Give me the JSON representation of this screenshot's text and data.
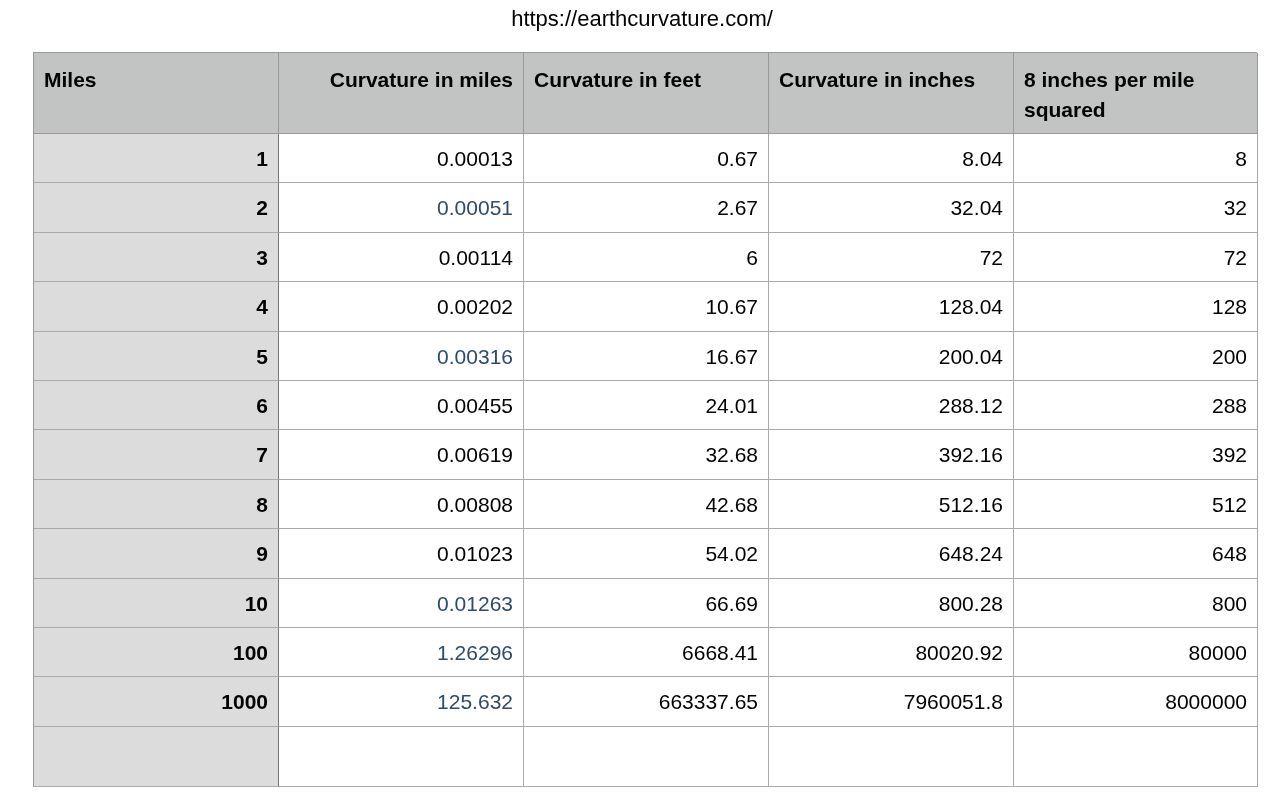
{
  "url": "https://earthcurvature.com/",
  "table": {
    "columns": [
      "Miles",
      "Curvature in miles",
      "Curvature in feet",
      "Curvature in inches",
      "8 inches per mile squared"
    ],
    "rows": [
      {
        "miles": "1",
        "curvature_miles": {
          "text": "0.00013",
          "color": "#000000"
        },
        "feet": "0.67",
        "inches": "8.04",
        "rule": "8"
      },
      {
        "miles": "2",
        "curvature_miles": {
          "text": "0.00051",
          "color": "#2e4a6e"
        },
        "feet": "2.67",
        "inches": "32.04",
        "rule": "32"
      },
      {
        "miles": "3",
        "curvature_miles": {
          "text": "0.00114",
          "color": "#000000"
        },
        "feet": "6",
        "inches": "72",
        "rule": "72"
      },
      {
        "miles": "4",
        "curvature_miles": {
          "text": "0.00202",
          "color": "#000000"
        },
        "feet": "10.67",
        "inches": "128.04",
        "rule": "128"
      },
      {
        "miles": "5",
        "curvature_miles": {
          "text": "0.00316",
          "color": "#2e4a6e"
        },
        "feet": "16.67",
        "inches": "200.04",
        "rule": "200"
      },
      {
        "miles": "6",
        "curvature_miles": {
          "text": "0.00455",
          "color": "#000000"
        },
        "feet": "24.01",
        "inches": "288.12",
        "rule": "288"
      },
      {
        "miles": "7",
        "curvature_miles": {
          "text": "0.00619",
          "color": "#000000"
        },
        "feet": "32.68",
        "inches": "392.16",
        "rule": "392"
      },
      {
        "miles": "8",
        "curvature_miles": {
          "text": "0.00808",
          "color": "#000000"
        },
        "feet": "42.68",
        "inches": "512.16",
        "rule": "512"
      },
      {
        "miles": "9",
        "curvature_miles": {
          "text": "0.01023",
          "color": "#000000"
        },
        "feet": "54.02",
        "inches": "648.24",
        "rule": "648"
      },
      {
        "miles": "10",
        "curvature_miles": {
          "text": "0.01263",
          "color": "#2e4a6e"
        },
        "feet": "66.69",
        "inches": "800.28",
        "rule": "800"
      },
      {
        "miles": "100",
        "curvature_miles": {
          "text": "1.26296",
          "color": "#2e4a6e"
        },
        "feet": "6668.41",
        "inches": "80020.92",
        "rule": "80000"
      },
      {
        "miles": "1000",
        "curvature_miles": {
          "text": "125.632",
          "color": "#2e4a6e"
        },
        "feet": "663337.65",
        "inches": "7960051.8",
        "rule": "8000000"
      }
    ]
  }
}
